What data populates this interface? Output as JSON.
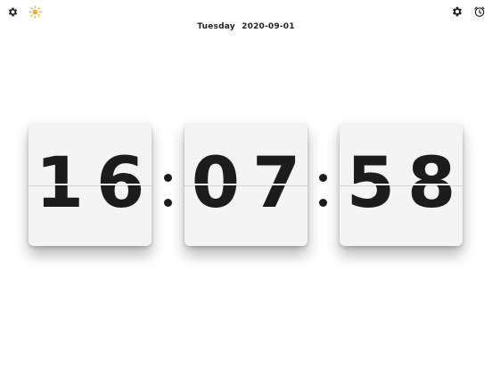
{
  "header": {
    "day": "Tuesday",
    "date": "2020-09-01",
    "icons": {
      "left_settings": "gear-icon",
      "brightness": "sun-icon",
      "right_settings": "gear-icon",
      "alarm": "alarm-clock-icon"
    },
    "colors": {
      "gear": "#222222",
      "sun": "#f2b600"
    }
  },
  "clock": {
    "hours": "16",
    "minutes": "07",
    "seconds": "58",
    "card_color": "#f4f4f4",
    "digit_color": "#1c1c1c"
  }
}
